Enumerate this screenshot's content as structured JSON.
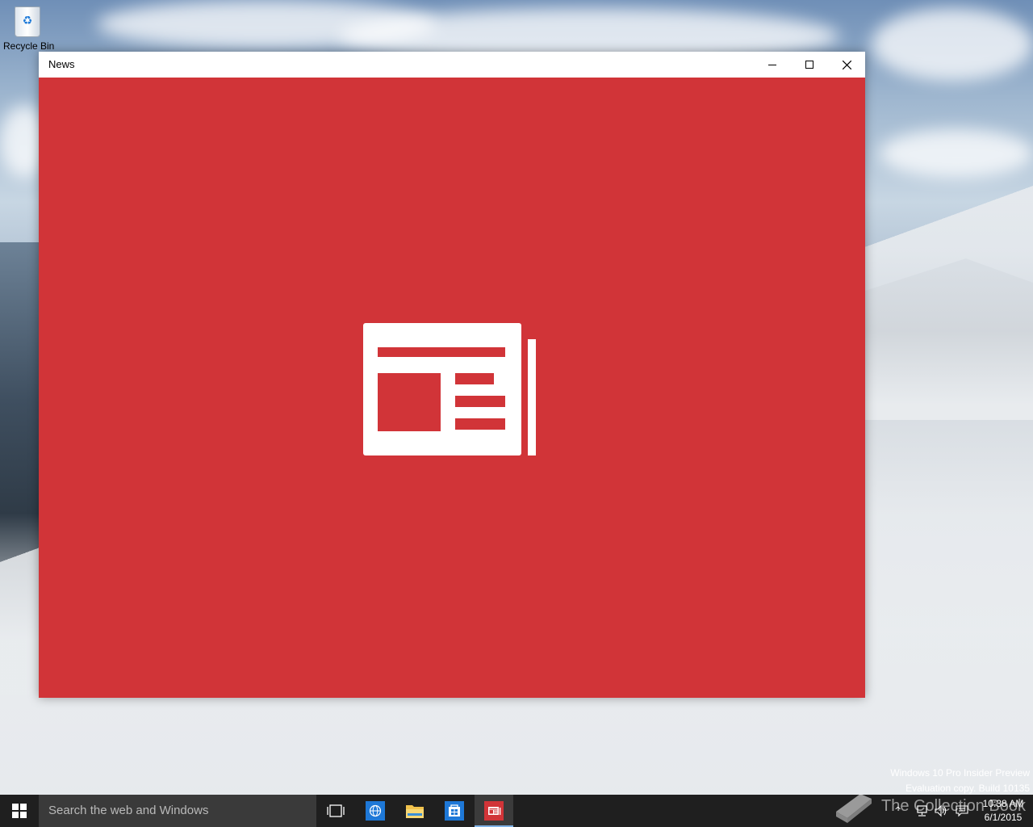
{
  "desktop": {
    "icons": [
      {
        "label": "Recycle Bin"
      }
    ],
    "watermark": {
      "line1": "Windows 10 Pro Insider Preview",
      "line2": "Evaluation copy. Build 10135"
    },
    "overlay_text": "The Collection Book"
  },
  "window": {
    "title": "News",
    "background_color": "#d13438",
    "splash_icon": "newspaper-icon"
  },
  "taskbar": {
    "search_placeholder": "Search the web and Windows",
    "pinned": [
      {
        "name": "task-view",
        "icon": "task-view-icon"
      },
      {
        "name": "edge",
        "icon": "globe-icon",
        "color": "#1e78d7"
      },
      {
        "name": "file-explorer",
        "icon": "folder-icon",
        "color": "#f1c24c"
      },
      {
        "name": "store",
        "icon": "store-icon",
        "color": "#1e78d7"
      },
      {
        "name": "news",
        "icon": "newspaper-icon",
        "color": "#d13438",
        "active": true
      }
    ],
    "clock": {
      "time": "10:38 AM",
      "date": "6/1/2015"
    }
  }
}
